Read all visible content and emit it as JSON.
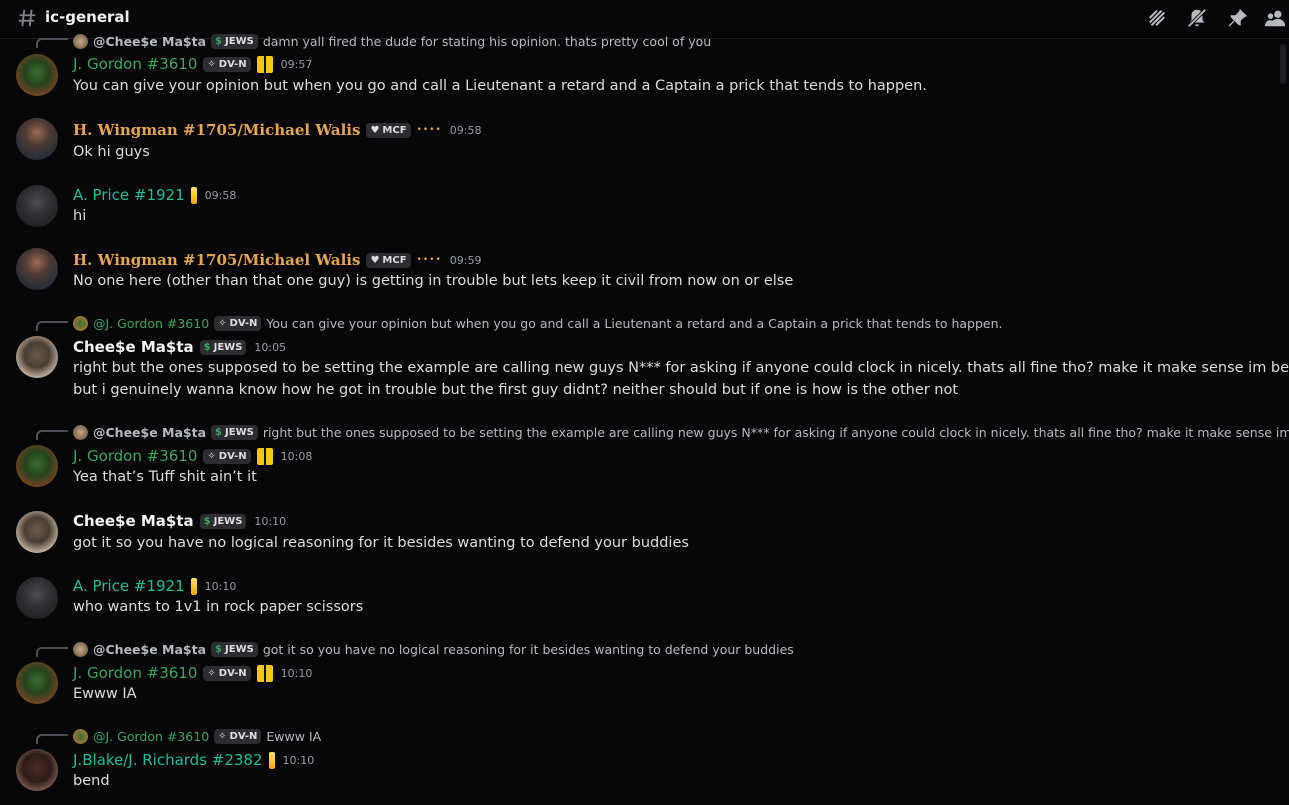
{
  "header": {
    "channel_name": "ic-general",
    "icons": [
      "hash-icon",
      "threads-icon",
      "mute-bell-icon",
      "pin-icon",
      "members-icon"
    ]
  },
  "colors": {
    "gordon": "#3ba55d",
    "wingman": "#e7a551",
    "price": "#1abc9c",
    "blake": "#1abc9c",
    "cheese": "#f2f3f5"
  },
  "messages": [
    {
      "reply": {
        "author": "@Chee$e Ma$ta",
        "tag": "JEWS",
        "text": "damn yall fired the dude for stating his opinion. thats pretty cool of you"
      },
      "author": "J. Gordon #3610",
      "tag": "DV-N",
      "time": "09:57",
      "text": [
        "You can give your opinion but when you go and call a Lieutenant a retard and a Captain a prick that tends to happen."
      ]
    },
    {
      "author": "H. Wingman #1705/Michael Walis",
      "tag": "MCF",
      "time": "09:58",
      "text": [
        "Ok hi guys"
      ]
    },
    {
      "author": "A. Price #1921",
      "time": "09:58",
      "text": [
        "hi"
      ]
    },
    {
      "author": "H. Wingman #1705/Michael Walis",
      "tag": "MCF",
      "time": "09:59",
      "text": [
        "No one here (other than that one guy) is getting in trouble but lets keep it civil from now on or else"
      ]
    },
    {
      "reply": {
        "author": "@J. Gordon #3610",
        "tag": "DV-N",
        "text": "You can give your opinion but when you go and call a Lieutenant a retard and a Captain a prick that tends to happen."
      },
      "author": "Chee$e Ma$ta",
      "tag": "JEWS",
      "time": "10:05",
      "text": [
        "right but the ones supposed to be setting the example are calling new guys N*** for asking if anyone could clock in nicely. thats all fine tho? make it make sense im being civil",
        "but i genuinely wanna know how he got in trouble but the first guy didnt? neither should but if one is how is the other not"
      ]
    },
    {
      "reply": {
        "author": "@Chee$e Ma$ta",
        "tag": "JEWS",
        "text": "right but the ones supposed to be setting the example are calling new guys N*** for asking if anyone could clock in nicely. thats all fine tho? make it make sense im being..."
      },
      "author": "J. Gordon #3610",
      "tag": "DV-N",
      "time": "10:08",
      "text": [
        "Yea that’s Tuff shit ain’t it"
      ]
    },
    {
      "author": "Chee$e Ma$ta",
      "tag": "JEWS",
      "time": "10:10",
      "text": [
        "got it so you have no logical reasoning for it besides wanting to defend your buddies"
      ]
    },
    {
      "author": "A. Price #1921",
      "time": "10:10",
      "text": [
        "who wants to 1v1 in rock paper scissors"
      ]
    },
    {
      "reply": {
        "author": "@Chee$e Ma$ta",
        "tag": "JEWS",
        "text": "got it so you have no logical reasoning for it besides wanting to defend your buddies"
      },
      "author": "J. Gordon #3610",
      "tag": "DV-N",
      "time": "10:10",
      "text": [
        "Ewww IA"
      ]
    },
    {
      "reply": {
        "author": "@J. Gordon #3610",
        "tag": "DV-N",
        "text": "Ewww IA"
      },
      "author": "J.Blake/J. Richards #2382",
      "time": "10:10",
      "text": [
        "bend"
      ]
    }
  ]
}
